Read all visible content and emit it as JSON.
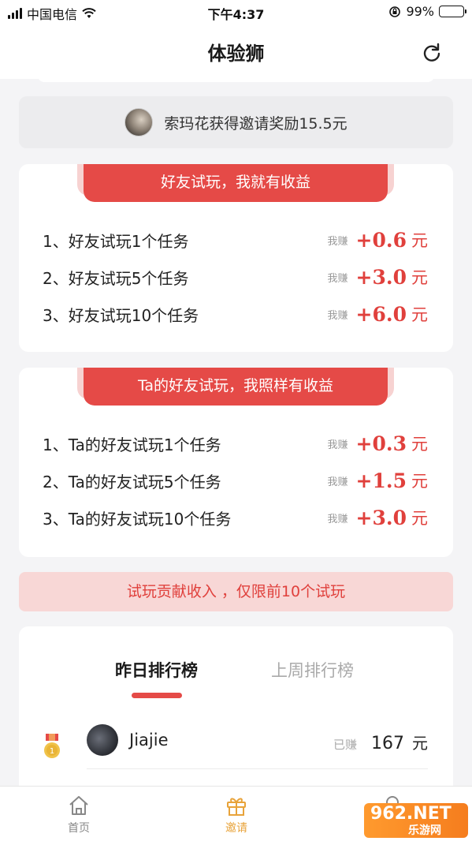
{
  "status_bar": {
    "carrier": "中国电信",
    "time": "下午4:37",
    "battery": "99%"
  },
  "navbar": {
    "title": "体验狮"
  },
  "notice": {
    "text": "索玛花获得邀请奖励15.5元"
  },
  "card1": {
    "banner": "好友试玩，我就有收益",
    "rows": [
      {
        "label": "1、好友试玩1个任务",
        "prefix": "我赚",
        "amount": "+0.6",
        "unit": "元"
      },
      {
        "label": "2、好友试玩5个任务",
        "prefix": "我赚",
        "amount": "+3.0",
        "unit": "元"
      },
      {
        "label": "3、好友试玩10个任务",
        "prefix": "我赚",
        "amount": "+6.0",
        "unit": "元"
      }
    ]
  },
  "card2": {
    "banner": "Ta的好友试玩，我照样有收益",
    "rows": [
      {
        "label": "1、Ta的好友试玩1个任务",
        "prefix": "我赚",
        "amount": "+0.3",
        "unit": "元"
      },
      {
        "label": "2、Ta的好友试玩5个任务",
        "prefix": "我赚",
        "amount": "+1.5",
        "unit": "元"
      },
      {
        "label": "3、Ta的好友试玩10个任务",
        "prefix": "我赚",
        "amount": "+3.0",
        "unit": "元"
      }
    ]
  },
  "limit_note": "试玩贡献收入 ，仅限前10个试玩",
  "ranking": {
    "tabs": [
      "昨日排行榜",
      "上周排行榜"
    ],
    "active_tab": 0,
    "entries": [
      {
        "rank_icon": "gold-medal-icon",
        "name": "Jiajie",
        "prefix": "已赚",
        "amount": "167",
        "unit": "元"
      }
    ]
  },
  "tabbar": {
    "items": [
      {
        "label": "首页",
        "icon": "home-icon",
        "active": false
      },
      {
        "label": "邀请",
        "icon": "gift-icon",
        "active": true
      },
      {
        "label": "",
        "icon": "profile-icon",
        "active": false
      }
    ]
  },
  "watermark": {
    "brand": "962.NET",
    "text": "乐游网"
  },
  "colors": {
    "accent_red": "#e54a47",
    "accent_orange": "#e8a33a",
    "banner_light": "#f8d7d6"
  }
}
